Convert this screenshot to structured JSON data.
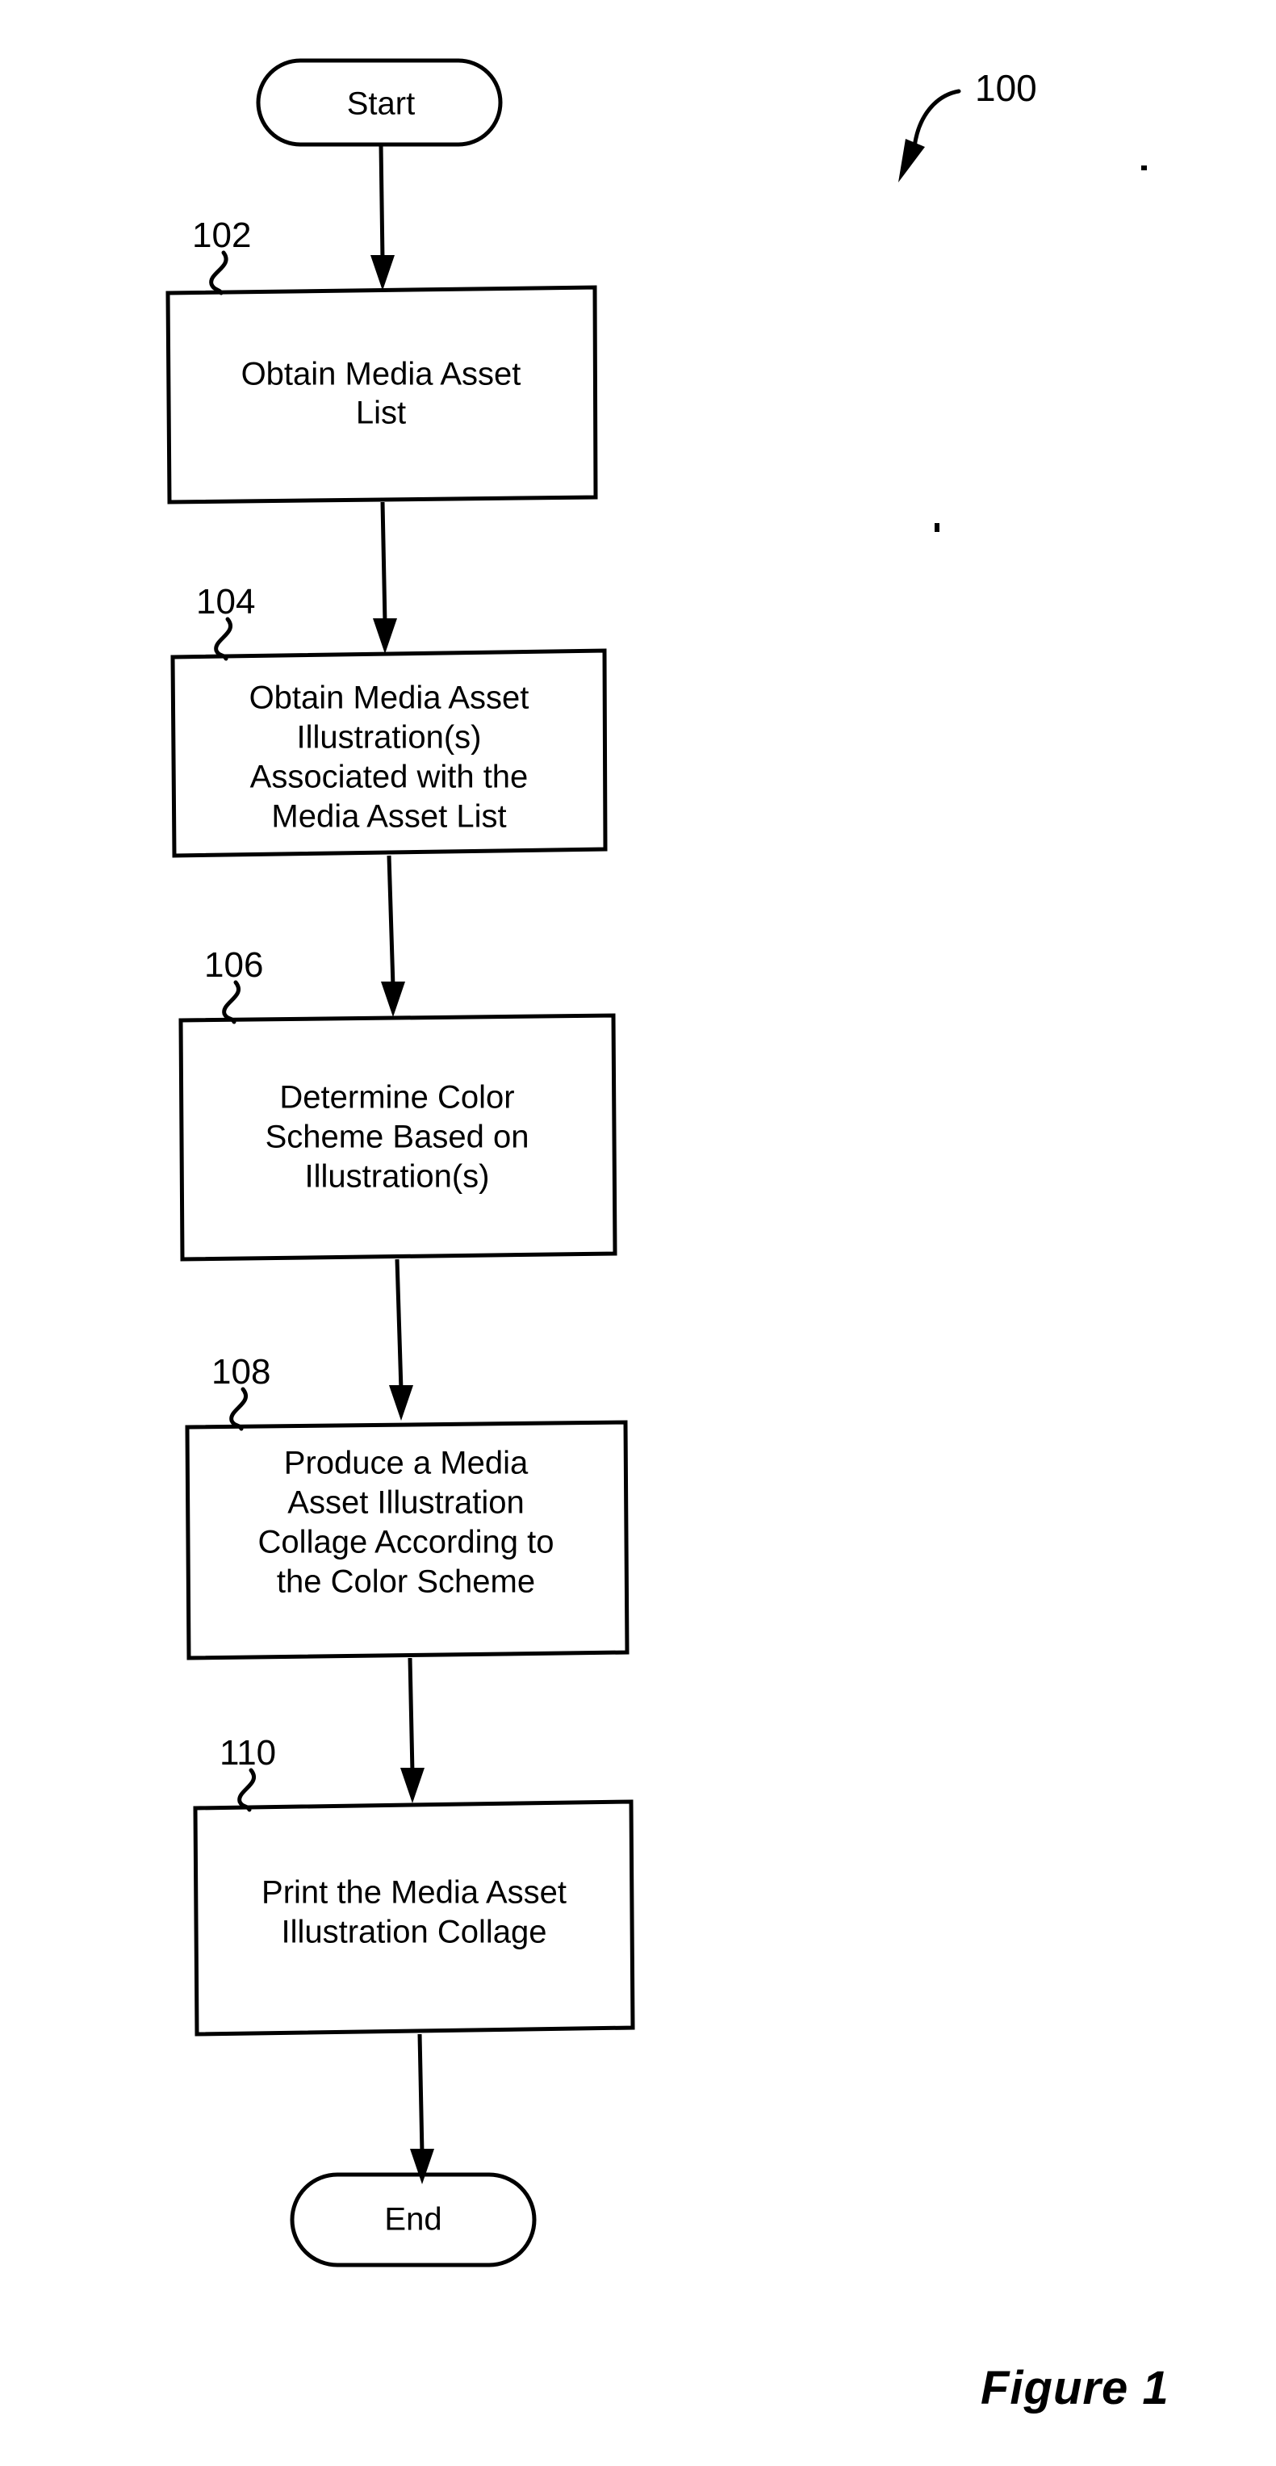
{
  "figure": {
    "caption": "Figure 1",
    "diagram_reference": "100"
  },
  "flowchart": {
    "type": "process-flowchart",
    "orientation": "top-to-bottom",
    "nodes": [
      {
        "id": "start",
        "shape": "terminal",
        "label": "Start",
        "ref": ""
      },
      {
        "id": "step-102",
        "shape": "process",
        "ref": "102",
        "lines": [
          "Obtain Media Asset",
          "List"
        ]
      },
      {
        "id": "step-104",
        "shape": "process",
        "ref": "104",
        "lines": [
          "Obtain Media Asset",
          "Illustration(s)",
          "Associated with the",
          "Media Asset List"
        ]
      },
      {
        "id": "step-106",
        "shape": "process",
        "ref": "106",
        "lines": [
          "Determine Color",
          "Scheme Based on",
          "Illustration(s)"
        ]
      },
      {
        "id": "step-108",
        "shape": "process",
        "ref": "108",
        "lines": [
          "Produce a Media",
          "Asset Illustration",
          "Collage According to",
          "the Color Scheme"
        ]
      },
      {
        "id": "step-110",
        "shape": "process",
        "ref": "110",
        "lines": [
          "Print the Media Asset",
          "Illustration Collage"
        ]
      },
      {
        "id": "end",
        "shape": "terminal",
        "label": "End",
        "ref": ""
      }
    ],
    "edges": [
      {
        "from": "start",
        "to": "step-102"
      },
      {
        "from": "step-102",
        "to": "step-104"
      },
      {
        "from": "step-104",
        "to": "step-106"
      },
      {
        "from": "step-106",
        "to": "step-108"
      },
      {
        "from": "step-108",
        "to": "step-110"
      },
      {
        "from": "step-110",
        "to": "end"
      }
    ]
  },
  "colors": {
    "ink": "#000000",
    "paper": "#ffffff"
  }
}
